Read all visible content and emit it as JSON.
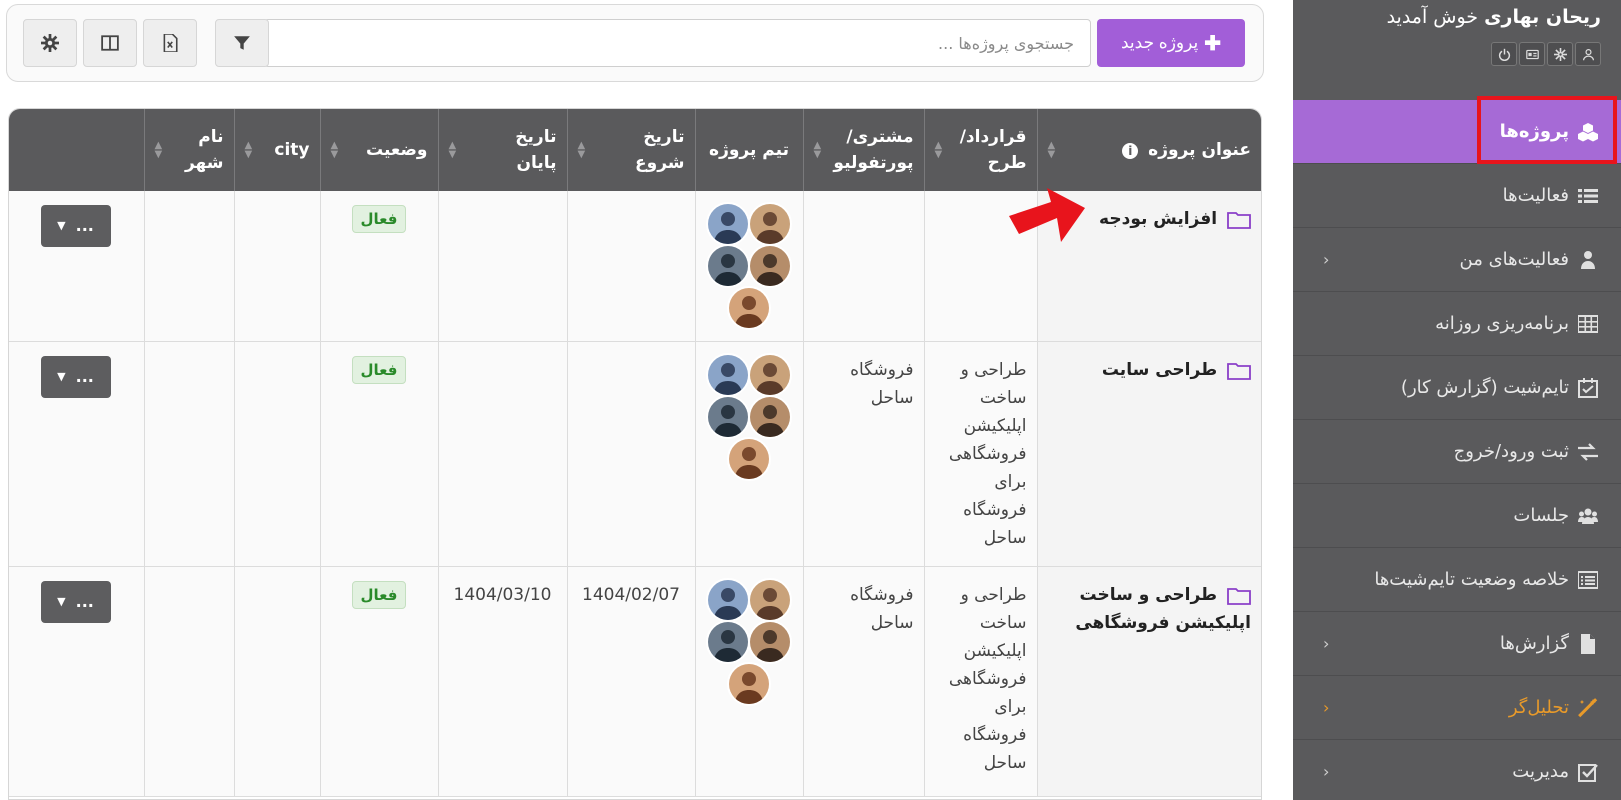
{
  "sidebar": {
    "welcome_name": "ریحان بهاری",
    "welcome_suffix": "خوش آمدید",
    "user_icons": [
      "user-icon",
      "gear-icon",
      "id-card-icon",
      "power-icon"
    ],
    "items": [
      {
        "label": "پروژه‌ها",
        "icon": "cubes-icon",
        "active": true,
        "chevron": false
      },
      {
        "label": "فعالیت‌ها",
        "icon": "list-icon",
        "active": false,
        "chevron": false
      },
      {
        "label": "فعالیت‌های من",
        "icon": "user-tasks-icon",
        "active": false,
        "chevron": true
      },
      {
        "label": "برنامه‌ریزی روزانه",
        "icon": "table-grid-icon",
        "active": false,
        "chevron": false
      },
      {
        "label": "تایم‌شیت (گزارش کار)",
        "icon": "calendar-check-icon",
        "active": false,
        "chevron": false
      },
      {
        "label": "ثبت ورود/خروج",
        "icon": "exchange-icon",
        "active": false,
        "chevron": false
      },
      {
        "label": "جلسات",
        "icon": "users-icon",
        "active": false,
        "chevron": false
      },
      {
        "label": "خلاصه وضعیت تایم‌شیت‌ها",
        "icon": "list-alt-icon",
        "active": false,
        "chevron": false
      },
      {
        "label": "گزارش‌ها",
        "icon": "file-icon",
        "active": false,
        "chevron": true
      },
      {
        "label": "تحلیل‌گر",
        "icon": "magic-wand-icon",
        "active": false,
        "chevron": true,
        "color": "#e89a2a"
      },
      {
        "label": "مدیریت",
        "icon": "check-square-icon",
        "active": false,
        "chevron": true
      }
    ],
    "chevron_glyph": "‹"
  },
  "toolbar": {
    "new_project_label": "پروژه جدید",
    "new_project_icon": "plus-icon",
    "search_placeholder": "جستجوی پروژه‌ها ...",
    "buttons": [
      "filter-icon",
      "excel-export-icon",
      "columns-icon",
      "settings-icon"
    ]
  },
  "table": {
    "headers": [
      {
        "label": "عنوان پروژه",
        "info_icon": true
      },
      {
        "label": "قرارداد/ طرح"
      },
      {
        "label": "مشتری/ پورتفولیو"
      },
      {
        "label": "تیم پروژه"
      },
      {
        "label": "تاریخ شروع"
      },
      {
        "label": "تاریخ پایان"
      },
      {
        "label": "وضعیت"
      },
      {
        "label": "city"
      },
      {
        "label": "نام شهر"
      },
      {
        "label": ""
      }
    ],
    "rows": [
      {
        "title": "افزایش بودجه",
        "contract": "",
        "client": "",
        "start": "",
        "end": "",
        "status": "فعال",
        "city": "",
        "city_name": "",
        "action": "..."
      },
      {
        "title": "طراحی سایت",
        "contract": "طراحی و ساخت اپلیکیشن فروشگاهی برای فروشگاه ساحل",
        "client": "فروشگاه ساحل",
        "start": "",
        "end": "",
        "status": "فعال",
        "city": "",
        "city_name": "",
        "action": "..."
      },
      {
        "title": "طراحی و ساخت اپلیکیشن فروشگاهی",
        "contract": "طراحی و ساخت اپلیکیشن فروشگاهی برای فروشگاه ساحل",
        "client": "فروشگاه ساحل",
        "start": "1404/02/07",
        "end": "1404/03/10",
        "status": "فعال",
        "city": "",
        "city_name": "",
        "action": "..."
      }
    ]
  },
  "colors": {
    "sidebar_bg": "#5a5a5c",
    "active_item": "#a66ad6",
    "primary_button": "#a25ed8",
    "header_bg": "#5a5a5c",
    "status_green": "#2a8a2a",
    "highlight_red": "#e8141c",
    "analyzer_orange": "#e89a2a"
  }
}
